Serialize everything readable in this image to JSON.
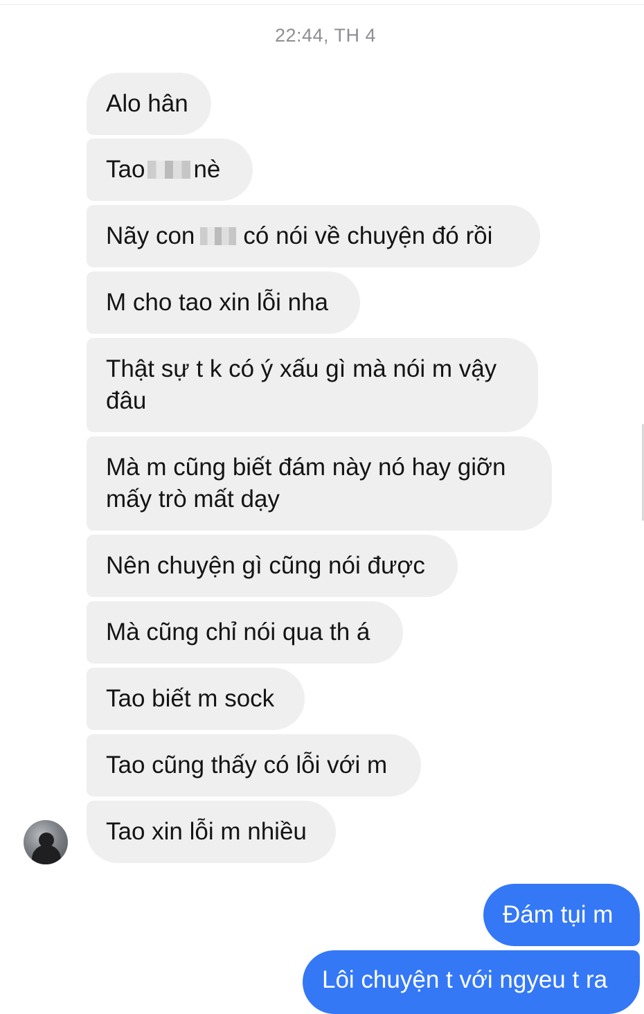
{
  "conversation": {
    "timestamp": "22:44, TH 4",
    "incoming": [
      {
        "text": "Alo hân"
      },
      {
        "text_before": "Tao",
        "text_after": "nè"
      },
      {
        "text_before": "Nãy con",
        "text_after": "có nói về chuyện đó rồi"
      },
      {
        "text": "M cho tao xin lỗi nha"
      },
      {
        "line1": "Thật sự t k có ý xấu gì mà nói m vậy",
        "line2": "đâu"
      },
      {
        "line1": "Mà m cũng biết đám này nó hay giỡn",
        "line2": "mấy trò mất dạy"
      },
      {
        "text": "Nên chuyện gì cũng nói được"
      },
      {
        "text": "Mà cũng chỉ nói qua th á"
      },
      {
        "text": "Tao biết m sock"
      },
      {
        "text": "Tao cũng thấy có lỗi với m"
      },
      {
        "text": "Tao xin lỗi m nhiều"
      }
    ],
    "outgoing": [
      {
        "text": "Đám tụi m"
      },
      {
        "text": "Lôi chuyện t với ngyeu t ra"
      }
    ]
  },
  "colors": {
    "incoming_bubble": "#efefef",
    "outgoing_bubble": "#3478f6",
    "timestamp_text": "#8e8e93"
  }
}
